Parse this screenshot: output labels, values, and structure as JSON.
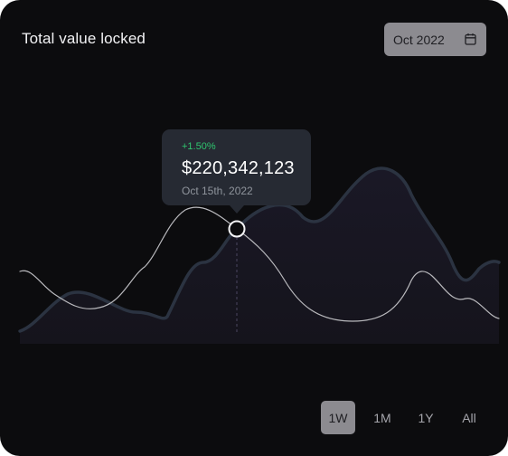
{
  "card": {
    "title": "Total value locked",
    "date_picker": {
      "label": "Oct 2022",
      "icon": "calendar-icon"
    }
  },
  "tooltip": {
    "change": "+1.50%",
    "value": "$220,342,123",
    "date": "Oct 15th, 2022"
  },
  "range_selector": {
    "options": [
      "1W",
      "1M",
      "1Y",
      "All"
    ],
    "selected": "1W"
  },
  "colors": {
    "background": "#0c0c0e",
    "primary_line": "#2b3341",
    "secondary_line": "#b9b9bd",
    "positive_change": "#2fc66f",
    "active_range": "#8c8b90"
  }
}
